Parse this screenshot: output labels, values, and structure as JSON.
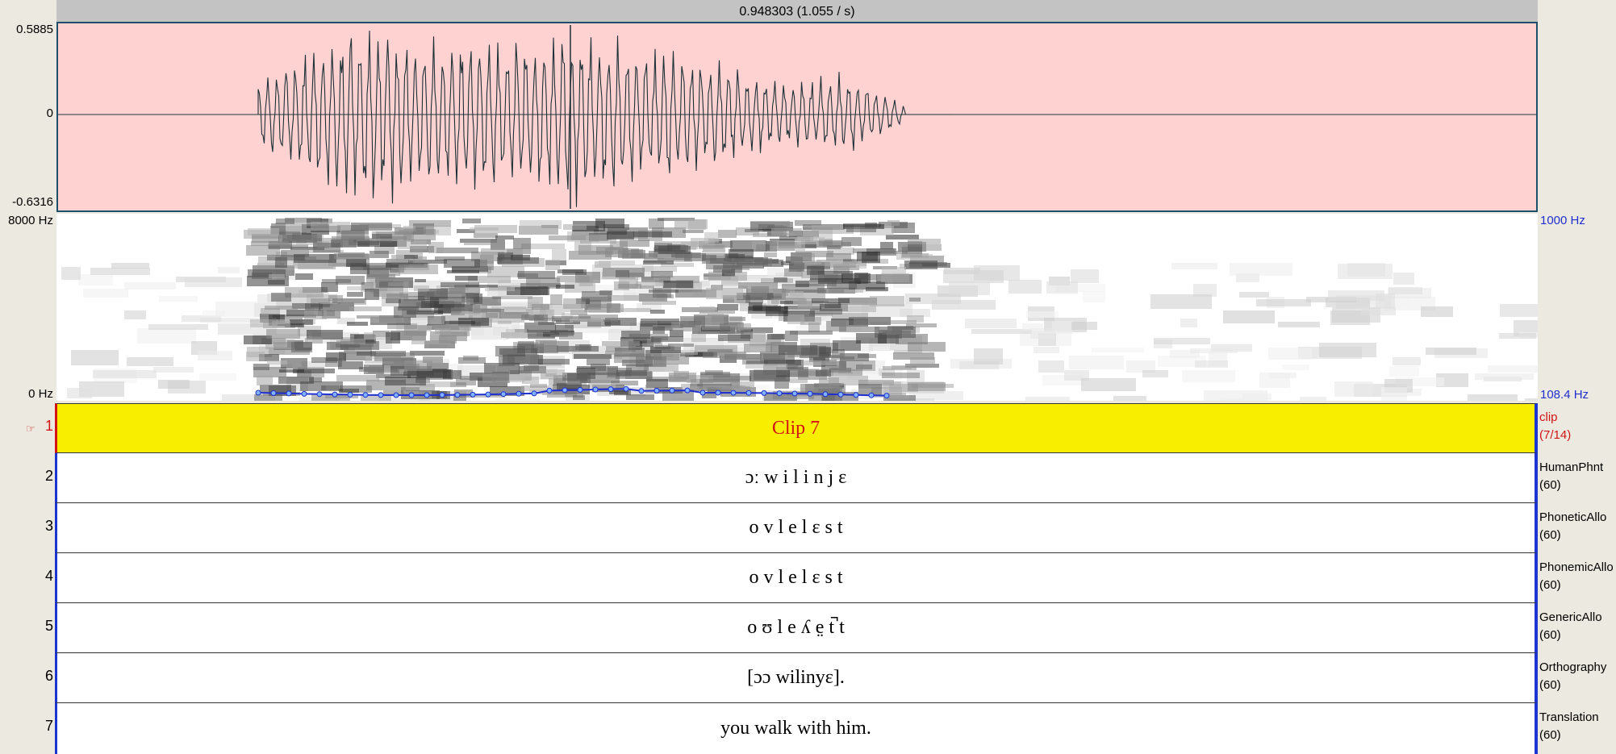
{
  "timebar": {
    "readout": "0.948303 (1.055 / s)"
  },
  "waveform": {
    "max_label": "0.5885",
    "zero_label": "0",
    "min_label": "-0.6316"
  },
  "spectrogram": {
    "freq_max_label": "8000 Hz",
    "freq_min_label": "0 Hz",
    "pitch_max_label": "1000 Hz",
    "pitch_min_label": "108.4 Hz"
  },
  "tiers": [
    {
      "number": "1",
      "text": "Clip 7",
      "name": "clip",
      "count": "(7/14)"
    },
    {
      "number": "2",
      "text": "ɔː w i l i n j ɛ",
      "name": "HumanPhnt",
      "count": "(60)"
    },
    {
      "number": "3",
      "text": "o v l e l ɛ s t",
      "name": "PhoneticAllo",
      "count": "(60)"
    },
    {
      "number": "4",
      "text": "o v l e l ɛ s t",
      "name": "PhonemicAllo",
      "count": "(60)"
    },
    {
      "number": "5",
      "text": "o ʊ l e ʎ e̤ t̚ t",
      "name": "GenericAllo",
      "count": "(60)"
    },
    {
      "number": "6",
      "text": "[ɔɔ wilinyɛ].",
      "name": "Orthography",
      "count": "(60)"
    },
    {
      "number": "7",
      "text": "you walk with him.",
      "name": "Translation",
      "count": "(60)"
    }
  ],
  "colors": {
    "waveform_bg": "#ffd2d2",
    "reference_tier_bg": "#f7ee00",
    "reference_text": "#d21414",
    "pitch_color": "#1f2fd0"
  },
  "icons": {
    "pointer": "hand-pointer-icon"
  }
}
